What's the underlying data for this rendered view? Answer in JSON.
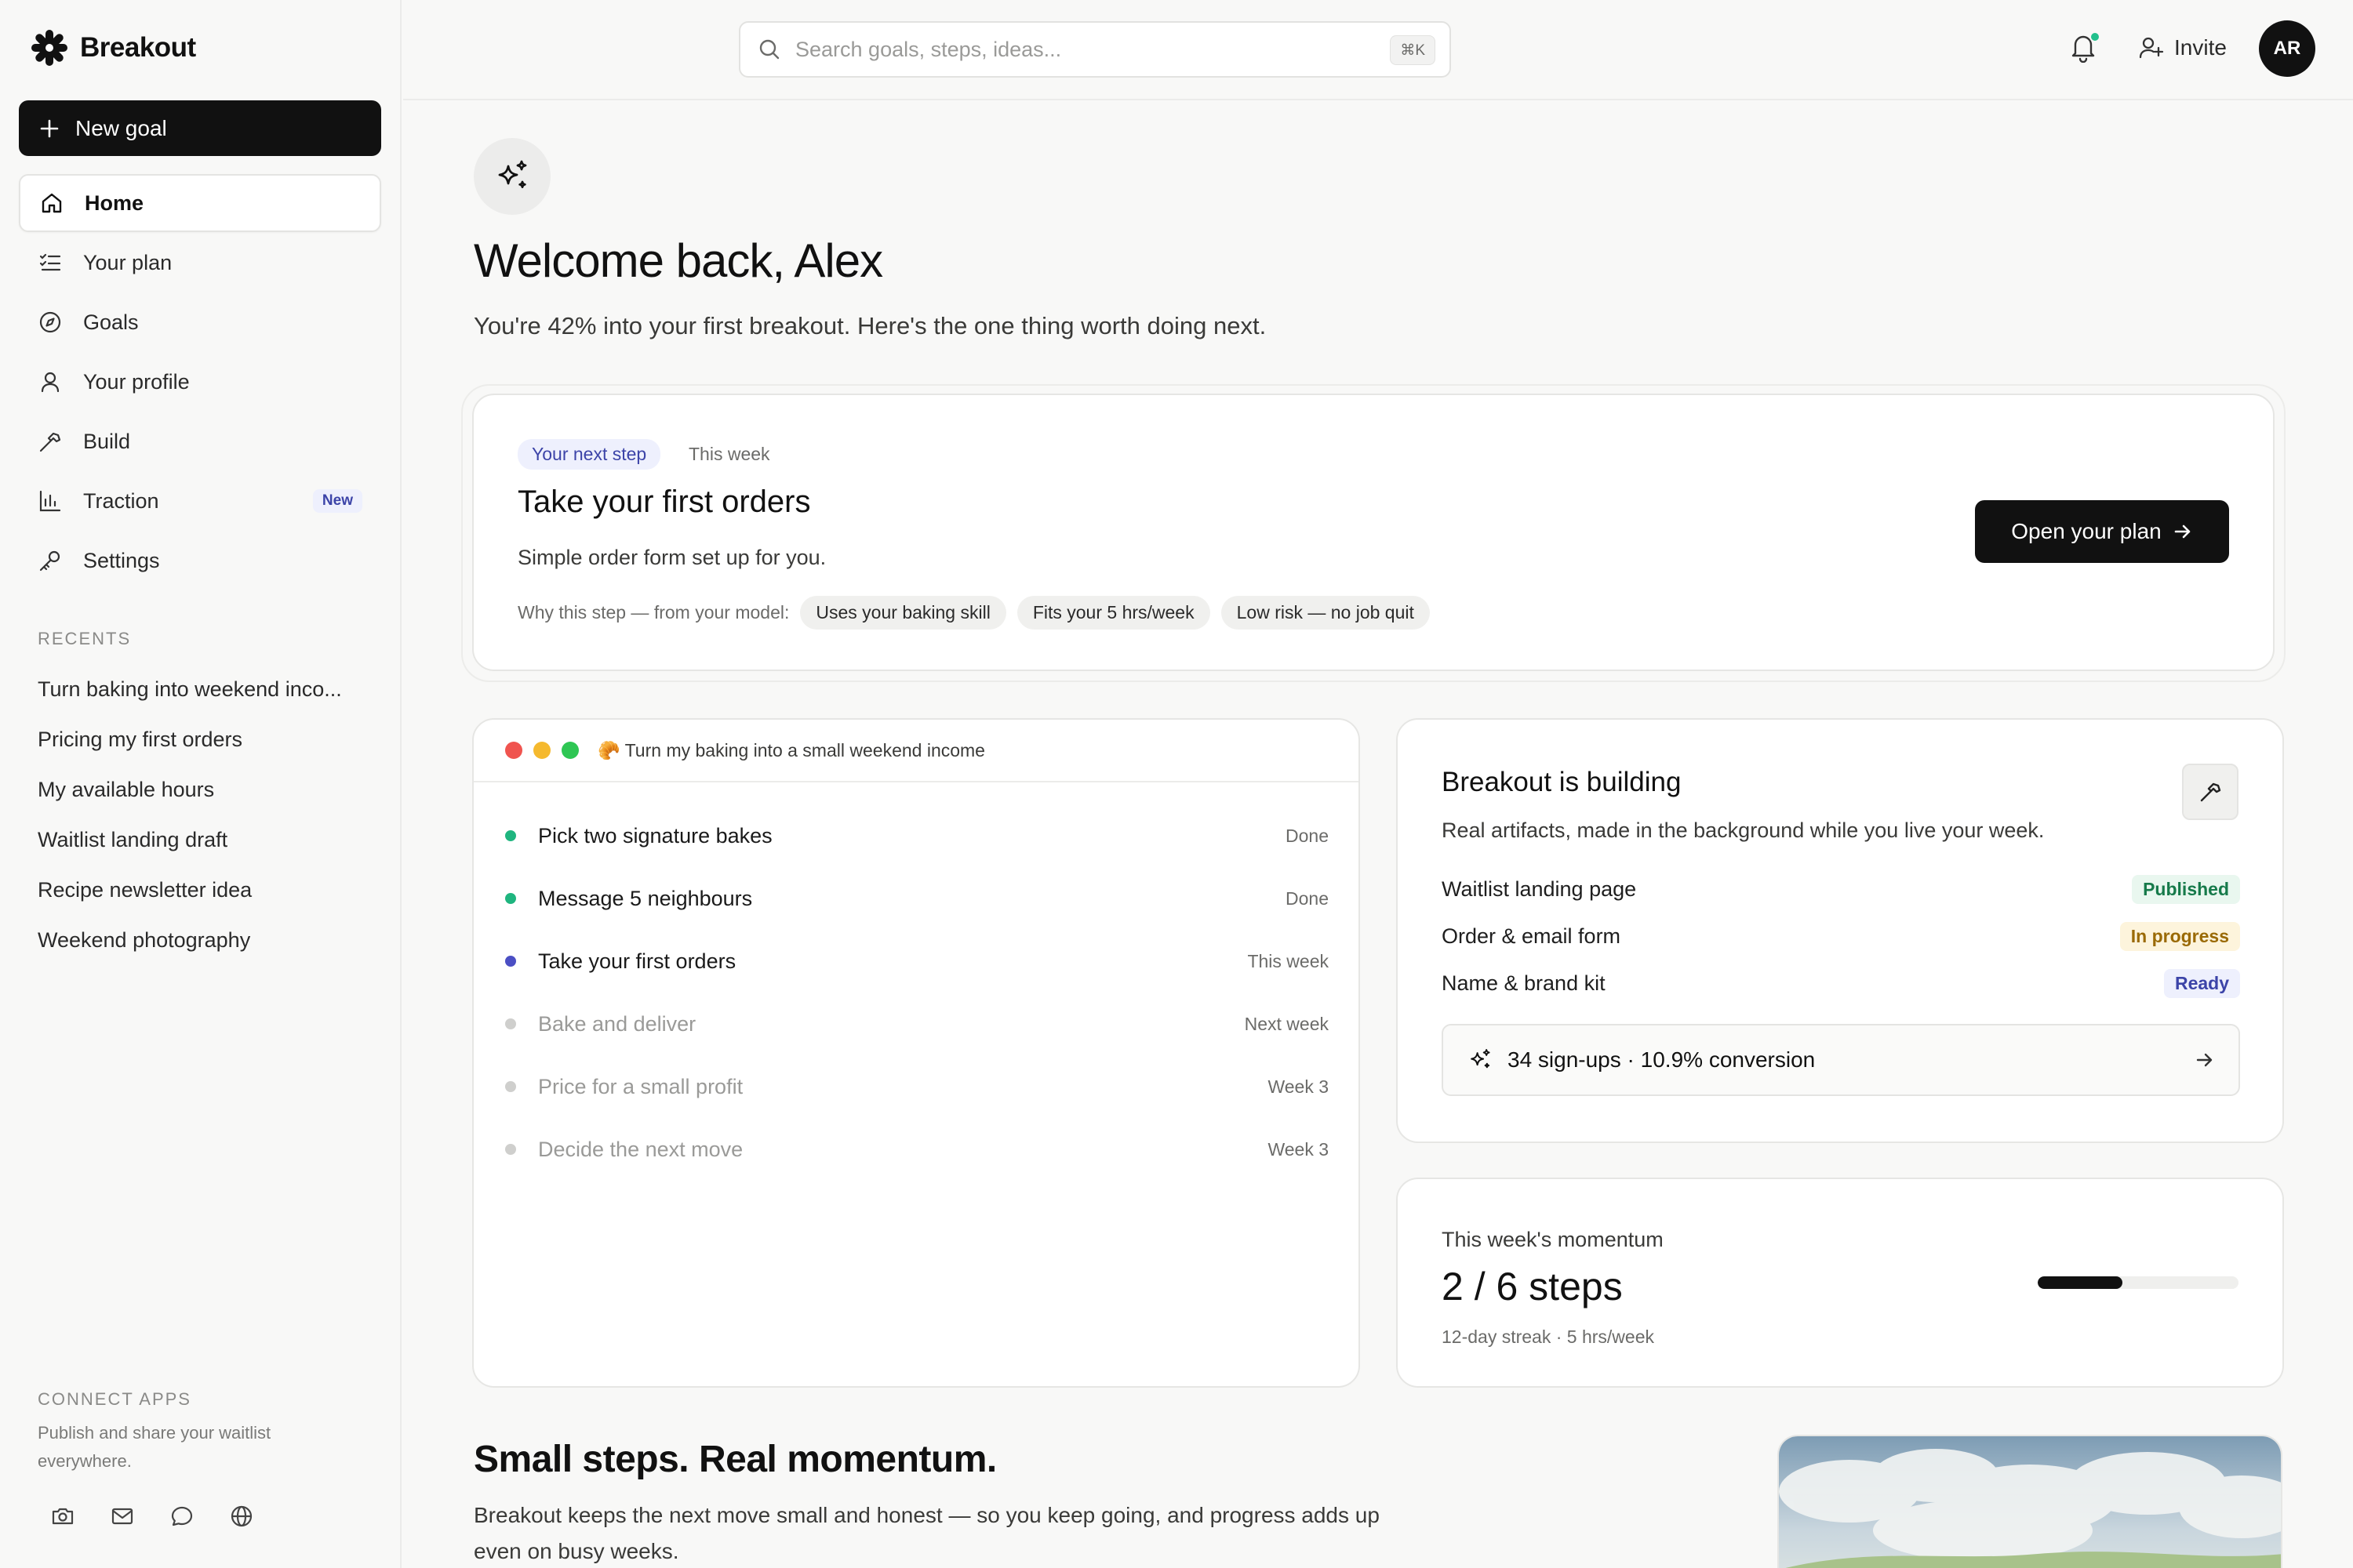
{
  "app": {
    "name": "Breakout"
  },
  "sidebar": {
    "new_goal": "New goal",
    "nav": [
      {
        "label": "Home"
      },
      {
        "label": "Your plan"
      },
      {
        "label": "Goals"
      },
      {
        "label": "Your profile"
      },
      {
        "label": "Build"
      },
      {
        "label": "Traction",
        "badge": "New"
      },
      {
        "label": "Settings"
      }
    ],
    "recents_label": "RECENTS",
    "recents": [
      "Turn baking into weekend inco...",
      "Pricing my first orders",
      "My available hours",
      "Waitlist landing draft",
      "Recipe newsletter idea",
      "Weekend photography"
    ],
    "connect_label": "CONNECT APPS",
    "connect_desc": "Publish and share your waitlist everywhere."
  },
  "topbar": {
    "search_placeholder": "Search goals, steps, ideas...",
    "shortcut": "⌘K",
    "invite": "Invite",
    "avatar": "AR"
  },
  "main": {
    "welcome": "Welcome back, Alex",
    "subtitle": "You're 42% into your first breakout. Here's the one thing worth doing next.",
    "next_step": {
      "tag": "Your next step",
      "when": "This week",
      "title": "Take your first orders",
      "desc": "Simple order form set up for you.",
      "why_label": "Why this step — from your model:",
      "chips": [
        "Uses your baking skill",
        "Fits your 5 hrs/week",
        "Low risk — no job quit"
      ],
      "cta": "Open your plan"
    },
    "plan": {
      "title": "🥐 Turn my baking into a small weekend income",
      "steps": [
        {
          "label": "Pick two signature bakes",
          "meta": "Done",
          "state": "done"
        },
        {
          "label": "Message 5 neighbours",
          "meta": "Done",
          "state": "done"
        },
        {
          "label": "Take your first orders",
          "meta": "This week",
          "state": "current"
        },
        {
          "label": "Bake and deliver",
          "meta": "Next week",
          "state": "upcoming"
        },
        {
          "label": "Price for a small profit",
          "meta": "Week 3",
          "state": "upcoming"
        },
        {
          "label": "Decide the next move",
          "meta": "Week 3",
          "state": "upcoming"
        }
      ]
    },
    "building": {
      "title": "Breakout is building",
      "desc": "Real artifacts, made in the background while you live your week.",
      "artifacts": [
        {
          "label": "Waitlist landing page",
          "status": "Published"
        },
        {
          "label": "Order & email form",
          "status": "In progress"
        },
        {
          "label": "Name & brand kit",
          "status": "Ready"
        }
      ],
      "stats": "34 sign-ups · 10.9% conversion"
    },
    "momentum": {
      "label": "This week's momentum",
      "value": "2 / 6 steps",
      "sub": "12-day streak · 5 hrs/week",
      "progress": 0.42
    },
    "section": {
      "title": "Small steps. Real momentum.",
      "desc": "Breakout keeps the next move small and honest — so you keep going, and progress adds up even on busy weeks."
    }
  },
  "colors": {
    "accent": "#111111",
    "done": "#1fb57f",
    "current": "#4b4fc4",
    "upcoming": "#cfcfcd",
    "published_bg": "#e9f7ef",
    "published_fg": "#167a4a",
    "progress_bg": "#fdf4dc",
    "progress_fg": "#9a6a05",
    "ready_bg": "#eef0fd",
    "ready_fg": "#3c44a8"
  }
}
